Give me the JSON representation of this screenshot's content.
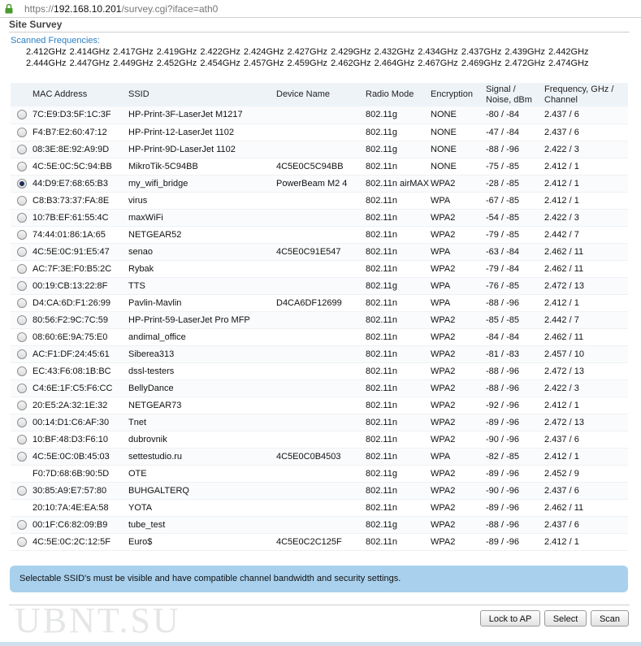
{
  "browser": {
    "url_scheme": "https://",
    "url_host": "192.168.10.201",
    "url_path": "/survey.cgi?iface=ath0"
  },
  "page": {
    "title": "Site Survey",
    "scanned_label": "Scanned Frequencies:",
    "frequencies": "2.412GHz 2.414GHz 2.417GHz 2.419GHz 2.422GHz 2.424GHz 2.427GHz 2.429GHz 2.432GHz 2.434GHz 2.437GHz 2.439GHz 2.442GHz 2.444GHz 2.447GHz 2.449GHz 2.452GHz 2.454GHz 2.457GHz 2.459GHz 2.462GHz 2.464GHz 2.467GHz 2.469GHz 2.472GHz 2.474GHz"
  },
  "table": {
    "headers": {
      "mac": "MAC Address",
      "ssid": "SSID",
      "device": "Device Name",
      "mode": "Radio Mode",
      "enc": "Encryption",
      "signal_1": "Signal /",
      "signal_2": "Noise, dBm",
      "freq_1": "Frequency, GHz /",
      "freq_2": "Channel"
    },
    "rows": [
      {
        "radio": true,
        "selected": false,
        "mac": "7C:E9:D3:5F:1C:3F",
        "ssid": "HP-Print-3F-LaserJet M1217",
        "device": "",
        "mode": "802.11g",
        "enc": "NONE",
        "signal": "-80 / -84",
        "freq": "2.437 / 6"
      },
      {
        "radio": true,
        "selected": false,
        "mac": "F4:B7:E2:60:47:12",
        "ssid": "HP-Print-12-LaserJet 1102",
        "device": "",
        "mode": "802.11g",
        "enc": "NONE",
        "signal": "-47 / -84",
        "freq": "2.437 / 6"
      },
      {
        "radio": true,
        "selected": false,
        "mac": "08:3E:8E:92:A9:9D",
        "ssid": "HP-Print-9D-LaserJet 1102",
        "device": "",
        "mode": "802.11g",
        "enc": "NONE",
        "signal": "-88 / -96",
        "freq": "2.422 / 3"
      },
      {
        "radio": true,
        "selected": false,
        "mac": "4C:5E:0C:5C:94:BB",
        "ssid": "MikroTik-5C94BB",
        "device": "4C5E0C5C94BB",
        "mode": "802.11n",
        "enc": "NONE",
        "signal": "-75 / -85",
        "freq": "2.412 / 1"
      },
      {
        "radio": true,
        "selected": true,
        "mac": "44:D9:E7:68:65:B3",
        "ssid": "my_wifi_bridge",
        "device": "PowerBeam M2 4",
        "mode": "802.11n airMAX",
        "enc": "WPA2",
        "signal": "-28 / -85",
        "freq": "2.412 / 1"
      },
      {
        "radio": true,
        "selected": false,
        "mac": "C8:B3:73:37:FA:8E",
        "ssid": "virus",
        "device": "",
        "mode": "802.11n",
        "enc": "WPA",
        "signal": "-67 / -85",
        "freq": "2.412 / 1"
      },
      {
        "radio": true,
        "selected": false,
        "mac": "10:7B:EF:61:55:4C",
        "ssid": "maxWiFi",
        "device": "",
        "mode": "802.11n",
        "enc": "WPA2",
        "signal": "-54 / -85",
        "freq": "2.422 / 3"
      },
      {
        "radio": true,
        "selected": false,
        "mac": "74:44:01:86:1A:65",
        "ssid": "NETGEAR52",
        "device": "",
        "mode": "802.11n",
        "enc": "WPA2",
        "signal": "-79 / -85",
        "freq": "2.442 / 7"
      },
      {
        "radio": true,
        "selected": false,
        "mac": "4C:5E:0C:91:E5:47",
        "ssid": "senao",
        "device": "4C5E0C91E547",
        "mode": "802.11n",
        "enc": "WPA",
        "signal": "-63 / -84",
        "freq": "2.462 / 11"
      },
      {
        "radio": true,
        "selected": false,
        "mac": "AC:7F:3E:F0:B5:2C",
        "ssid": "Rybak",
        "device": "",
        "mode": "802.11n",
        "enc": "WPA2",
        "signal": "-79 / -84",
        "freq": "2.462 / 11"
      },
      {
        "radio": true,
        "selected": false,
        "mac": "00:19:CB:13:22:8F",
        "ssid": "TTS",
        "device": "",
        "mode": "802.11g",
        "enc": "WPA",
        "signal": "-76 / -85",
        "freq": "2.472 / 13"
      },
      {
        "radio": true,
        "selected": false,
        "mac": "D4:CA:6D:F1:26:99",
        "ssid": "Pavlin-Mavlin",
        "device": "D4CA6DF12699",
        "mode": "802.11n",
        "enc": "WPA",
        "signal": "-88 / -96",
        "freq": "2.412 / 1"
      },
      {
        "radio": true,
        "selected": false,
        "mac": "80:56:F2:9C:7C:59",
        "ssid": "HP-Print-59-LaserJet Pro MFP",
        "device": "",
        "mode": "802.11n",
        "enc": "WPA2",
        "signal": "-85 / -85",
        "freq": "2.442 / 7"
      },
      {
        "radio": true,
        "selected": false,
        "mac": "08:60:6E:9A:75:E0",
        "ssid": "andimal_office",
        "device": "",
        "mode": "802.11n",
        "enc": "WPA2",
        "signal": "-84 / -84",
        "freq": "2.462 / 11"
      },
      {
        "radio": true,
        "selected": false,
        "mac": "AC:F1:DF:24:45:61",
        "ssid": "Siberea313",
        "device": "",
        "mode": "802.11n",
        "enc": "WPA2",
        "signal": "-81 / -83",
        "freq": "2.457 / 10"
      },
      {
        "radio": true,
        "selected": false,
        "mac": "EC:43:F6:08:1B:BC",
        "ssid": "dssl-testers",
        "device": "",
        "mode": "802.11n",
        "enc": "WPA2",
        "signal": "-88 / -96",
        "freq": "2.472 / 13"
      },
      {
        "radio": true,
        "selected": false,
        "mac": "C4:6E:1F:C5:F6:CC",
        "ssid": "BellyDance",
        "device": "",
        "mode": "802.11n",
        "enc": "WPA2",
        "signal": "-88 / -96",
        "freq": "2.422 / 3"
      },
      {
        "radio": true,
        "selected": false,
        "mac": "20:E5:2A:32:1E:32",
        "ssid": "NETGEAR73",
        "device": "",
        "mode": "802.11n",
        "enc": "WPA2",
        "signal": "-92 / -96",
        "freq": "2.412 / 1"
      },
      {
        "radio": true,
        "selected": false,
        "mac": "00:14:D1:C6:AF:30",
        "ssid": "Tnet",
        "device": "",
        "mode": "802.11n",
        "enc": "WPA2",
        "signal": "-89 / -96",
        "freq": "2.472 / 13"
      },
      {
        "radio": true,
        "selected": false,
        "mac": "10:BF:48:D3:F6:10",
        "ssid": "dubrovnik",
        "device": "",
        "mode": "802.11n",
        "enc": "WPA2",
        "signal": "-90 / -96",
        "freq": "2.437 / 6"
      },
      {
        "radio": true,
        "selected": false,
        "mac": "4C:5E:0C:0B:45:03",
        "ssid": "settestudio.ru",
        "device": "4C5E0C0B4503",
        "mode": "802.11n",
        "enc": "WPA",
        "signal": "-82 / -85",
        "freq": "2.412 / 1"
      },
      {
        "radio": false,
        "selected": false,
        "mac": "F0:7D:68:6B:90:5D",
        "ssid": "OTE",
        "device": "",
        "mode": "802.11g",
        "enc": "WPA2",
        "signal": "-89 / -96",
        "freq": "2.452 / 9"
      },
      {
        "radio": true,
        "selected": false,
        "mac": "30:85:A9:E7:57:80",
        "ssid": "BUHGALTERQ",
        "device": "",
        "mode": "802.11n",
        "enc": "WPA2",
        "signal": "-90 / -96",
        "freq": "2.437 / 6"
      },
      {
        "radio": false,
        "selected": false,
        "mac": "20:10:7A:4E:EA:58",
        "ssid": "YOTA",
        "device": "",
        "mode": "802.11n",
        "enc": "WPA2",
        "signal": "-89 / -96",
        "freq": "2.462 / 11"
      },
      {
        "radio": true,
        "selected": false,
        "mac": "00:1F:C6:82:09:B9",
        "ssid": "tube_test",
        "device": "",
        "mode": "802.11g",
        "enc": "WPA2",
        "signal": "-88 / -96",
        "freq": "2.437 / 6"
      },
      {
        "radio": true,
        "selected": false,
        "mac": "4C:5E:0C:2C:12:5F",
        "ssid": "Euro$",
        "device": "4C5E0C2C125F",
        "mode": "802.11n",
        "enc": "WPA2",
        "signal": "-89 / -96",
        "freq": "2.412 / 1"
      }
    ]
  },
  "notice": "Selectable SSID's must be visible and have compatible channel bandwidth and security settings.",
  "watermark": "UBNT.SU",
  "buttons": {
    "lock": "Lock to AP",
    "select": "Select",
    "scan": "Scan"
  },
  "colors": {
    "link_blue": "#2a7fc4",
    "notice_bg": "#a9d1ee",
    "header_bg": "#eef3f8",
    "lock_green": "#4a9a2e"
  }
}
